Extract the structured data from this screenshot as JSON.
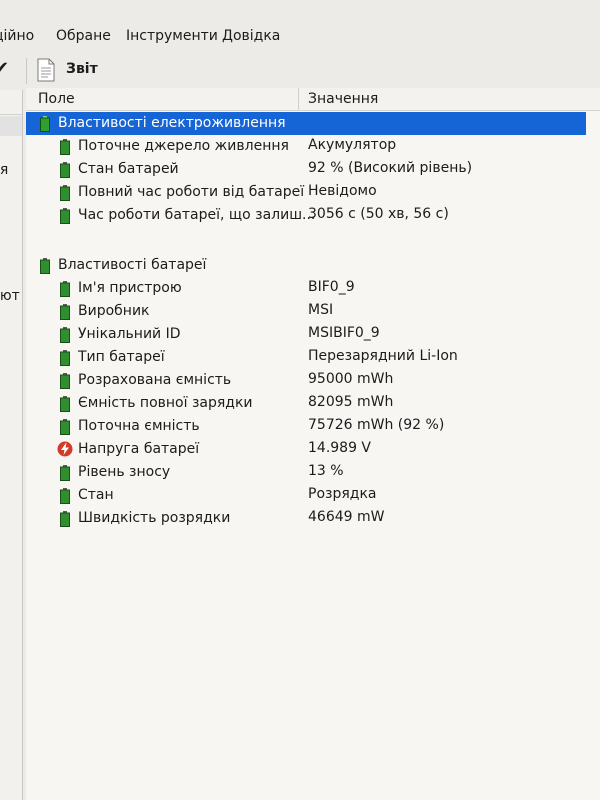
{
  "menu": [
    "ційно",
    "Обране",
    "Інструменти",
    "Довідка"
  ],
  "toolbar": {
    "check_icon": "✔",
    "report_label": "Звіт"
  },
  "left_fragments": [
    "ія",
    "'ют"
  ],
  "header": {
    "field": "Поле",
    "value": "Значення"
  },
  "groups": {
    "power": {
      "title": "Властивості електроживлення",
      "rows": [
        {
          "field": "Поточне джерело живлення",
          "value": "Акумулятор",
          "icon": "battery-icon"
        },
        {
          "field": "Стан батарей",
          "value": "92 % (Високий рівень)",
          "icon": "battery-icon"
        },
        {
          "field": "Повний час роботи від батареї",
          "value": "Невідомо",
          "icon": "battery-icon"
        },
        {
          "field": "Час роботи батареї, що залиш...",
          "value": "3056 с (50 хв, 56 с)",
          "icon": "battery-icon"
        }
      ]
    },
    "battery": {
      "title": "Властивості батареї",
      "rows": [
        {
          "field": "Ім'я пристрою",
          "value": "BIF0_9",
          "icon": "battery-icon"
        },
        {
          "field": "Виробник",
          "value": "MSI",
          "icon": "battery-icon"
        },
        {
          "field": "Унікальний ID",
          "value": "MSIBIF0_9",
          "icon": "battery-icon"
        },
        {
          "field": "Тип батареї",
          "value": "Перезарядний Li-Ion",
          "icon": "battery-icon"
        },
        {
          "field": "Розрахована ємність",
          "value": "95000 mWh",
          "icon": "battery-icon"
        },
        {
          "field": "Ємність повної зарядки",
          "value": "82095 mWh",
          "icon": "battery-icon"
        },
        {
          "field": "Поточна ємність",
          "value": "75726 mWh  (92 %)",
          "icon": "battery-icon"
        },
        {
          "field": "Напруга батареї",
          "value": "14.989 V",
          "icon": "voltage-icon"
        },
        {
          "field": "Рівень зносу",
          "value": "13 %",
          "icon": "battery-icon"
        },
        {
          "field": "Стан",
          "value": "Розрядка",
          "icon": "battery-icon"
        },
        {
          "field": "Швидкість розрядки",
          "value": "46649 mW",
          "icon": "battery-icon"
        }
      ]
    }
  },
  "colors": {
    "selection": "#1565d6",
    "battery_green": "#2f8f2f",
    "voltage_red": "#d23a2a"
  }
}
